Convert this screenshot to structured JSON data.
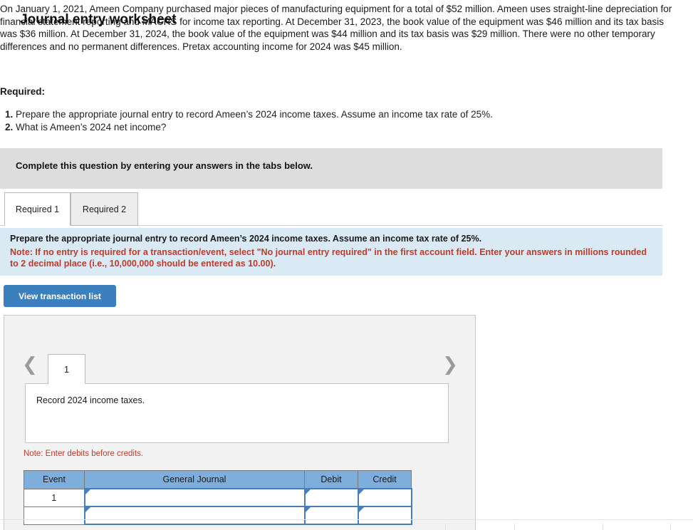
{
  "problem": {
    "text": "On January 1, 2021, Ameen Company purchased major pieces of manufacturing equipment for a total of $52 million. Ameen uses straight-line depreciation for financial statement reporting and MACRS for income tax reporting. At December 31, 2023, the book value of the equipment was $46 million and its tax basis was $36 million. At December 31, 2024, the book value of the equipment was $44 million and its tax basis was $29 million. There were no other temporary differences and no permanent differences. Pretax accounting income for 2024 was $45 million."
  },
  "required": {
    "heading": "Required:",
    "items": [
      {
        "num": "1.",
        "text": "Prepare the appropriate journal entry to record Ameen’s 2024 income taxes. Assume an income tax rate of 25%."
      },
      {
        "num": "2.",
        "text": "What is Ameen’s 2024 net income?"
      }
    ]
  },
  "instruction_bar": {
    "text": "Complete this question by entering your answers in the tabs below."
  },
  "tabs": [
    {
      "label": "Required 1",
      "active": true
    },
    {
      "label": "Required 2",
      "active": false
    }
  ],
  "info_panel": {
    "line1": "Prepare the appropriate journal entry to record Ameen’s 2024 income taxes. Assume an income tax rate of 25%.",
    "note": "Note: If no entry is required for a transaction/event, select \"No journal entry required\" in the first account field. Enter your answers in millions rounded to 2 decimal place (i.e., 10,000,000 should be entered as 10.00).",
    "background": "#daeaf5",
    "note_color": "#c0392b"
  },
  "buttons": {
    "view_transaction_list": "View transaction list",
    "view_transaction_list_color": "#3c7fbd"
  },
  "worksheet": {
    "title": "Journal entry worksheet",
    "nav": {
      "prev_icon": "chevron-left-icon",
      "next_icon": "chevron-right-icon"
    },
    "pages": [
      {
        "label": "1",
        "active": true
      }
    ],
    "description": "Record 2024 income taxes.",
    "debit_note": "Note: Enter debits before credits.",
    "table": {
      "headers": [
        "Event",
        "General Journal",
        "Debit",
        "Credit"
      ],
      "header_color": "#7eafdc",
      "rows": [
        {
          "event": "1",
          "general_journal": "",
          "debit": "",
          "credit": ""
        },
        {
          "event": "",
          "general_journal": "",
          "debit": "",
          "credit": ""
        }
      ]
    }
  }
}
